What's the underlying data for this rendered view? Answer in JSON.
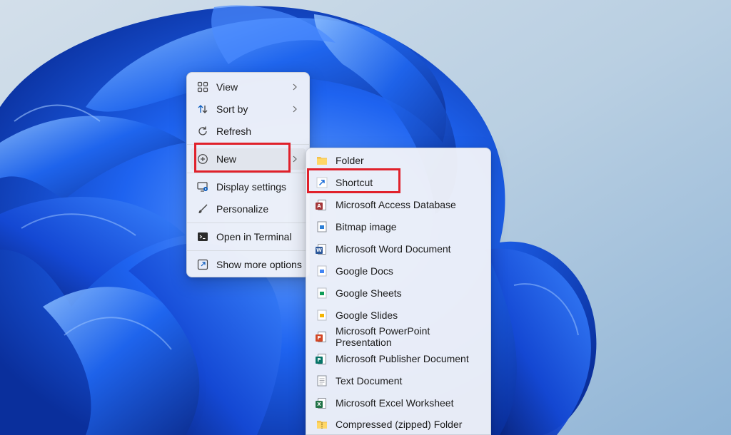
{
  "context_menu": {
    "items": [
      {
        "label": "View",
        "icon": "grid-icon",
        "has_submenu": true
      },
      {
        "label": "Sort by",
        "icon": "sort-arrows-icon",
        "has_submenu": true
      },
      {
        "label": "Refresh",
        "icon": "refresh-icon",
        "has_submenu": false
      },
      {
        "label": "New",
        "icon": "plus-circle-icon",
        "has_submenu": true,
        "state": "highlighted"
      },
      {
        "label": "Display settings",
        "icon": "display-settings-icon",
        "has_submenu": false
      },
      {
        "label": "Personalize",
        "icon": "brush-icon",
        "has_submenu": false
      },
      {
        "label": "Open in Terminal",
        "icon": "terminal-icon",
        "has_submenu": false
      },
      {
        "label": "Show more options",
        "icon": "show-more-icon",
        "has_submenu": false
      }
    ]
  },
  "new_submenu": {
    "items": [
      {
        "label": "Folder",
        "icon": "folder-icon"
      },
      {
        "label": "Shortcut",
        "icon": "shortcut-icon",
        "state": "highlighted"
      },
      {
        "label": "Microsoft Access Database",
        "icon": "access-icon"
      },
      {
        "label": "Bitmap image",
        "icon": "bitmap-icon"
      },
      {
        "label": "Microsoft Word Document",
        "icon": "word-icon"
      },
      {
        "label": "Google Docs",
        "icon": "google-docs-icon"
      },
      {
        "label": "Google Sheets",
        "icon": "google-sheets-icon"
      },
      {
        "label": "Google Slides",
        "icon": "google-slides-icon"
      },
      {
        "label": "Microsoft PowerPoint Presentation",
        "icon": "powerpoint-icon"
      },
      {
        "label": "Microsoft Publisher Document",
        "icon": "publisher-icon"
      },
      {
        "label": "Text Document",
        "icon": "text-document-icon"
      },
      {
        "label": "Microsoft Excel Worksheet",
        "icon": "excel-icon"
      },
      {
        "label": "Compressed (zipped) Folder",
        "icon": "zip-folder-icon"
      }
    ]
  },
  "colors": {
    "highlight_border": "#e0212b",
    "wallpaper_blue": "#1f5fe0",
    "menu_bg": "#f0f3f9"
  }
}
